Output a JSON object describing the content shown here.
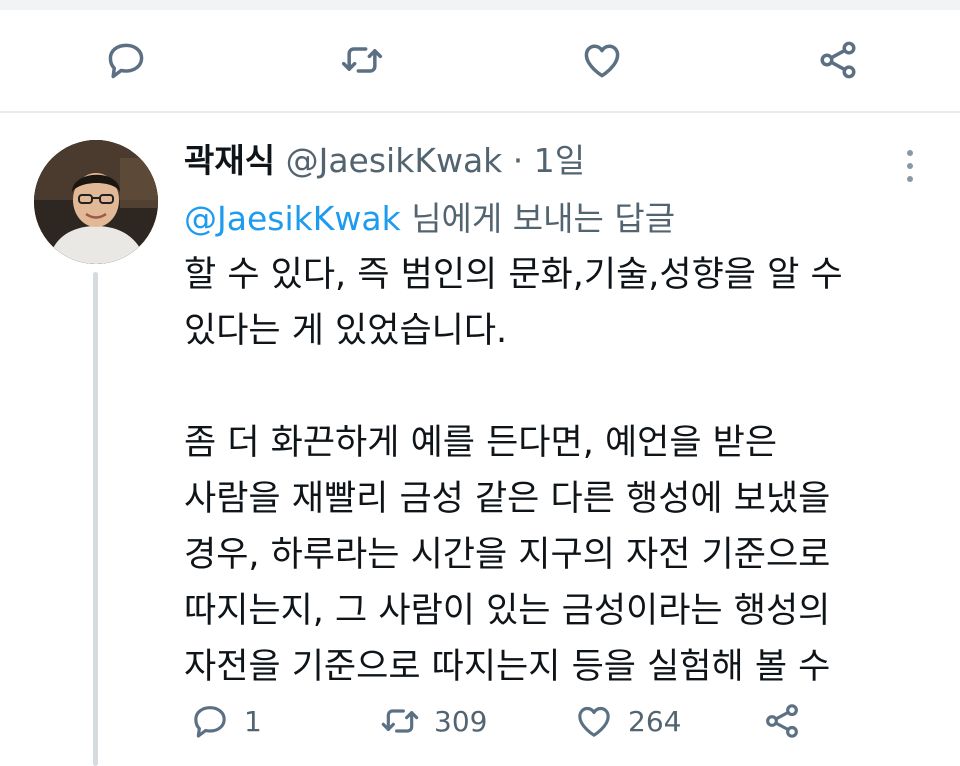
{
  "top_actions": {
    "icons": [
      "reply-icon",
      "retweet-icon",
      "like-icon",
      "share-icon"
    ]
  },
  "tweet": {
    "display_name": "곽재식",
    "handle": "@JaesikKwak",
    "separator": "·",
    "time": "1일",
    "reply_to": {
      "mention": "@JaesikKwak",
      "suffix": " 님에게 보내는 답글"
    },
    "body": {
      "p1_line1": "할 수 있다, 즉 범인의 문화,기술,성향을 알 수",
      "p1_line2": "있다는 게 있었습니다.",
      "p2_line1": "좀 더 화끈하게 예를 든다면, 예언을 받은",
      "p2_line2": "사람을 재빨리 금성 같은 다른 행성에 보냈을",
      "p2_line3": "경우, 하루라는 시간을 지구의 자전 기준으로",
      "p2_line4": "따지는지, 그 사람이 있는 금성이라는 행성의",
      "p2_line5": "자전을 기준으로 따지는지 등을 실험해 볼 수"
    },
    "stats": {
      "replies": "1",
      "retweets": "309",
      "likes": "264"
    }
  },
  "colors": {
    "text": "#0f1419",
    "secondary": "#536471",
    "link": "#1d9bf0",
    "icon": "#5b7083",
    "divider": "#e6ecf0",
    "thread_line": "#d6dbe0"
  }
}
